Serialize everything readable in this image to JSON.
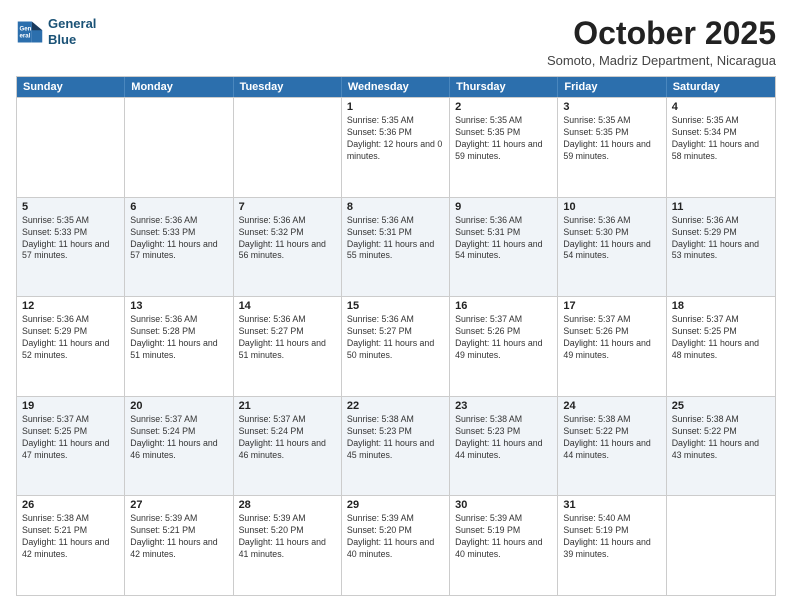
{
  "header": {
    "logo_line1": "General",
    "logo_line2": "Blue",
    "month": "October 2025",
    "location": "Somoto, Madriz Department, Nicaragua"
  },
  "day_headers": [
    "Sunday",
    "Monday",
    "Tuesday",
    "Wednesday",
    "Thursday",
    "Friday",
    "Saturday"
  ],
  "weeks": [
    [
      {
        "number": "",
        "sunrise": "",
        "sunset": "",
        "daylight": ""
      },
      {
        "number": "",
        "sunrise": "",
        "sunset": "",
        "daylight": ""
      },
      {
        "number": "",
        "sunrise": "",
        "sunset": "",
        "daylight": ""
      },
      {
        "number": "1",
        "sunrise": "Sunrise: 5:35 AM",
        "sunset": "Sunset: 5:36 PM",
        "daylight": "Daylight: 12 hours and 0 minutes."
      },
      {
        "number": "2",
        "sunrise": "Sunrise: 5:35 AM",
        "sunset": "Sunset: 5:35 PM",
        "daylight": "Daylight: 11 hours and 59 minutes."
      },
      {
        "number": "3",
        "sunrise": "Sunrise: 5:35 AM",
        "sunset": "Sunset: 5:35 PM",
        "daylight": "Daylight: 11 hours and 59 minutes."
      },
      {
        "number": "4",
        "sunrise": "Sunrise: 5:35 AM",
        "sunset": "Sunset: 5:34 PM",
        "daylight": "Daylight: 11 hours and 58 minutes."
      }
    ],
    [
      {
        "number": "5",
        "sunrise": "Sunrise: 5:35 AM",
        "sunset": "Sunset: 5:33 PM",
        "daylight": "Daylight: 11 hours and 57 minutes."
      },
      {
        "number": "6",
        "sunrise": "Sunrise: 5:36 AM",
        "sunset": "Sunset: 5:33 PM",
        "daylight": "Daylight: 11 hours and 57 minutes."
      },
      {
        "number": "7",
        "sunrise": "Sunrise: 5:36 AM",
        "sunset": "Sunset: 5:32 PM",
        "daylight": "Daylight: 11 hours and 56 minutes."
      },
      {
        "number": "8",
        "sunrise": "Sunrise: 5:36 AM",
        "sunset": "Sunset: 5:31 PM",
        "daylight": "Daylight: 11 hours and 55 minutes."
      },
      {
        "number": "9",
        "sunrise": "Sunrise: 5:36 AM",
        "sunset": "Sunset: 5:31 PM",
        "daylight": "Daylight: 11 hours and 54 minutes."
      },
      {
        "number": "10",
        "sunrise": "Sunrise: 5:36 AM",
        "sunset": "Sunset: 5:30 PM",
        "daylight": "Daylight: 11 hours and 54 minutes."
      },
      {
        "number": "11",
        "sunrise": "Sunrise: 5:36 AM",
        "sunset": "Sunset: 5:29 PM",
        "daylight": "Daylight: 11 hours and 53 minutes."
      }
    ],
    [
      {
        "number": "12",
        "sunrise": "Sunrise: 5:36 AM",
        "sunset": "Sunset: 5:29 PM",
        "daylight": "Daylight: 11 hours and 52 minutes."
      },
      {
        "number": "13",
        "sunrise": "Sunrise: 5:36 AM",
        "sunset": "Sunset: 5:28 PM",
        "daylight": "Daylight: 11 hours and 51 minutes."
      },
      {
        "number": "14",
        "sunrise": "Sunrise: 5:36 AM",
        "sunset": "Sunset: 5:27 PM",
        "daylight": "Daylight: 11 hours and 51 minutes."
      },
      {
        "number": "15",
        "sunrise": "Sunrise: 5:36 AM",
        "sunset": "Sunset: 5:27 PM",
        "daylight": "Daylight: 11 hours and 50 minutes."
      },
      {
        "number": "16",
        "sunrise": "Sunrise: 5:37 AM",
        "sunset": "Sunset: 5:26 PM",
        "daylight": "Daylight: 11 hours and 49 minutes."
      },
      {
        "number": "17",
        "sunrise": "Sunrise: 5:37 AM",
        "sunset": "Sunset: 5:26 PM",
        "daylight": "Daylight: 11 hours and 49 minutes."
      },
      {
        "number": "18",
        "sunrise": "Sunrise: 5:37 AM",
        "sunset": "Sunset: 5:25 PM",
        "daylight": "Daylight: 11 hours and 48 minutes."
      }
    ],
    [
      {
        "number": "19",
        "sunrise": "Sunrise: 5:37 AM",
        "sunset": "Sunset: 5:25 PM",
        "daylight": "Daylight: 11 hours and 47 minutes."
      },
      {
        "number": "20",
        "sunrise": "Sunrise: 5:37 AM",
        "sunset": "Sunset: 5:24 PM",
        "daylight": "Daylight: 11 hours and 46 minutes."
      },
      {
        "number": "21",
        "sunrise": "Sunrise: 5:37 AM",
        "sunset": "Sunset: 5:24 PM",
        "daylight": "Daylight: 11 hours and 46 minutes."
      },
      {
        "number": "22",
        "sunrise": "Sunrise: 5:38 AM",
        "sunset": "Sunset: 5:23 PM",
        "daylight": "Daylight: 11 hours and 45 minutes."
      },
      {
        "number": "23",
        "sunrise": "Sunrise: 5:38 AM",
        "sunset": "Sunset: 5:23 PM",
        "daylight": "Daylight: 11 hours and 44 minutes."
      },
      {
        "number": "24",
        "sunrise": "Sunrise: 5:38 AM",
        "sunset": "Sunset: 5:22 PM",
        "daylight": "Daylight: 11 hours and 44 minutes."
      },
      {
        "number": "25",
        "sunrise": "Sunrise: 5:38 AM",
        "sunset": "Sunset: 5:22 PM",
        "daylight": "Daylight: 11 hours and 43 minutes."
      }
    ],
    [
      {
        "number": "26",
        "sunrise": "Sunrise: 5:38 AM",
        "sunset": "Sunset: 5:21 PM",
        "daylight": "Daylight: 11 hours and 42 minutes."
      },
      {
        "number": "27",
        "sunrise": "Sunrise: 5:39 AM",
        "sunset": "Sunset: 5:21 PM",
        "daylight": "Daylight: 11 hours and 42 minutes."
      },
      {
        "number": "28",
        "sunrise": "Sunrise: 5:39 AM",
        "sunset": "Sunset: 5:20 PM",
        "daylight": "Daylight: 11 hours and 41 minutes."
      },
      {
        "number": "29",
        "sunrise": "Sunrise: 5:39 AM",
        "sunset": "Sunset: 5:20 PM",
        "daylight": "Daylight: 11 hours and 40 minutes."
      },
      {
        "number": "30",
        "sunrise": "Sunrise: 5:39 AM",
        "sunset": "Sunset: 5:19 PM",
        "daylight": "Daylight: 11 hours and 40 minutes."
      },
      {
        "number": "31",
        "sunrise": "Sunrise: 5:40 AM",
        "sunset": "Sunset: 5:19 PM",
        "daylight": "Daylight: 11 hours and 39 minutes."
      },
      {
        "number": "",
        "sunrise": "",
        "sunset": "",
        "daylight": ""
      }
    ]
  ]
}
